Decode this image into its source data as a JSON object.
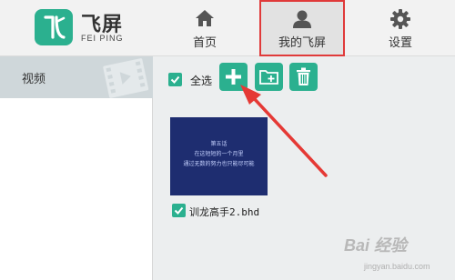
{
  "brand": {
    "name": "飞屏",
    "sub": "FEI PING"
  },
  "nav": {
    "home": {
      "label": "首页",
      "icon": "home-icon"
    },
    "mine": {
      "label": "我的飞屏",
      "icon": "user-icon"
    },
    "settings": {
      "label": "设置",
      "icon": "gear-icon"
    }
  },
  "sidebar": {
    "items": [
      {
        "label": "视频",
        "icon": "film-icon"
      }
    ]
  },
  "toolbar": {
    "select_all_label": "全选",
    "buttons": [
      {
        "name": "add",
        "icon": "plus-icon"
      },
      {
        "name": "new-folder",
        "icon": "folder-add-icon"
      },
      {
        "name": "delete",
        "icon": "trash-icon"
      }
    ]
  },
  "files": [
    {
      "name": "训龙高手2.bhd",
      "checked": true,
      "thumbnail_text": [
        "第五话",
        "在这短短的一个月里",
        "通过无数的努力也只能尽可能"
      ]
    }
  ],
  "watermark": {
    "text": "Bai 经验",
    "sub": "jingyan.baidu.com"
  },
  "colors": {
    "accent": "#2bb08f",
    "highlight": "#e03a3a",
    "sidebar_selected": "#cfd7da"
  }
}
